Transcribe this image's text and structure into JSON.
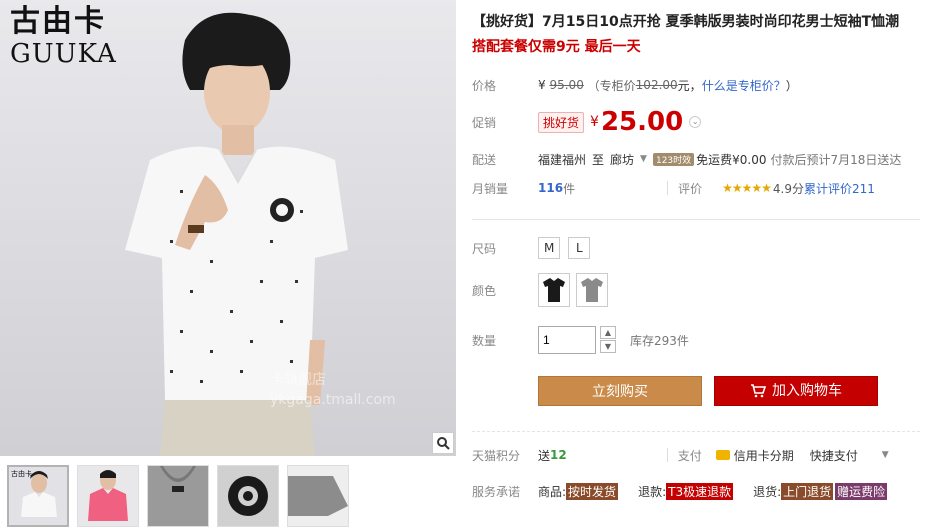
{
  "brand": {
    "cn": "古由卡",
    "en": "GUUKA"
  },
  "gallery": {
    "watermark_line1": "卡旗舰店",
    "watermark_line2": "ykgaga.tmall.com"
  },
  "product": {
    "title": "【挑好货】7月15日10点开抢 夏季韩版男装时尚印花男士短袖T恤潮",
    "subtitle": "搭配套餐仅需9元 最后一天"
  },
  "price": {
    "label": "价格",
    "currency": "¥",
    "original": "95.00",
    "counter_prefix": "（专柜价",
    "counter": "102.00",
    "counter_suffix": "元，",
    "counter_link": "什么是专柜价？",
    "counter_close": "）"
  },
  "promo": {
    "label": "促销",
    "badge": "挑好货",
    "currency": "¥",
    "price": "25.00"
  },
  "shipping": {
    "label": "配送",
    "from": "福建福州",
    "to_word": "至",
    "to": "廊坊",
    "badge": "123时效",
    "fee": "免运费¥0.00",
    "eta": "付款后预计7月18日送达"
  },
  "sales": {
    "label": "月销量",
    "count": "116",
    "unit": "件",
    "rating_label": "评价",
    "stars": "★★★★★",
    "score": "4.9分",
    "reviews": "累计评价211"
  },
  "size": {
    "label": "尺码",
    "options": [
      "M",
      "L"
    ]
  },
  "color": {
    "label": "颜色",
    "options": [
      "black",
      "gray"
    ],
    "swatch_colors": [
      "#1a1a1a",
      "#8a8a8a"
    ]
  },
  "quantity": {
    "label": "数量",
    "value": "1",
    "stock": "库存293件"
  },
  "actions": {
    "buy_now": "立刻购买",
    "add_to_cart": "加入购物车"
  },
  "points": {
    "label": "天猫积分",
    "prefix": "送",
    "value": "12"
  },
  "payment": {
    "label": "支付",
    "credit": "信用卡分期",
    "quick": "快捷支付"
  },
  "service": {
    "label": "服务承诺",
    "goods_prefix": "商品:",
    "goods_tag": "按时发货",
    "refund_prefix": "退款:",
    "refund_tag": "T3极速退款",
    "return_prefix": "退货:",
    "return_tag": "上门退货",
    "insurance_tag": "赠运费险"
  },
  "colors": {
    "accent": "#c40000",
    "buy": "#c98a4a",
    "link": "#3366cc"
  }
}
